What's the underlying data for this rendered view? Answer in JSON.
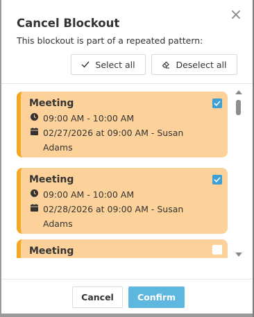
{
  "dialog": {
    "title": "Cancel Blockout",
    "subtitle": "This blockout is part of a repeated pattern:",
    "close_icon": "close-icon"
  },
  "actions": {
    "select_all_label": "Select all",
    "deselect_all_label": "Deselect all"
  },
  "items": [
    {
      "title": "Meeting",
      "time": "09:00 AM - 10:00 AM",
      "details": "02/27/2026 at 09:00 AM - Susan Adams",
      "checked": true
    },
    {
      "title": "Meeting",
      "time": "09:00 AM - 10:00 AM",
      "details": "02/28/2026 at 09:00 AM - Susan Adams",
      "checked": true
    },
    {
      "title": "Meeting",
      "checked": false
    }
  ],
  "footer": {
    "cancel_label": "Cancel",
    "confirm_label": "Confirm"
  },
  "colors": {
    "card_background": "#fdd29a",
    "card_accent": "#f5a623",
    "checkbox_checked": "#3e9fd5",
    "confirm_button": "#5db7df"
  },
  "icons": {
    "clock": "clock-icon",
    "calendar": "calendar-icon",
    "check": "check-icon",
    "eraser": "eraser-icon"
  }
}
